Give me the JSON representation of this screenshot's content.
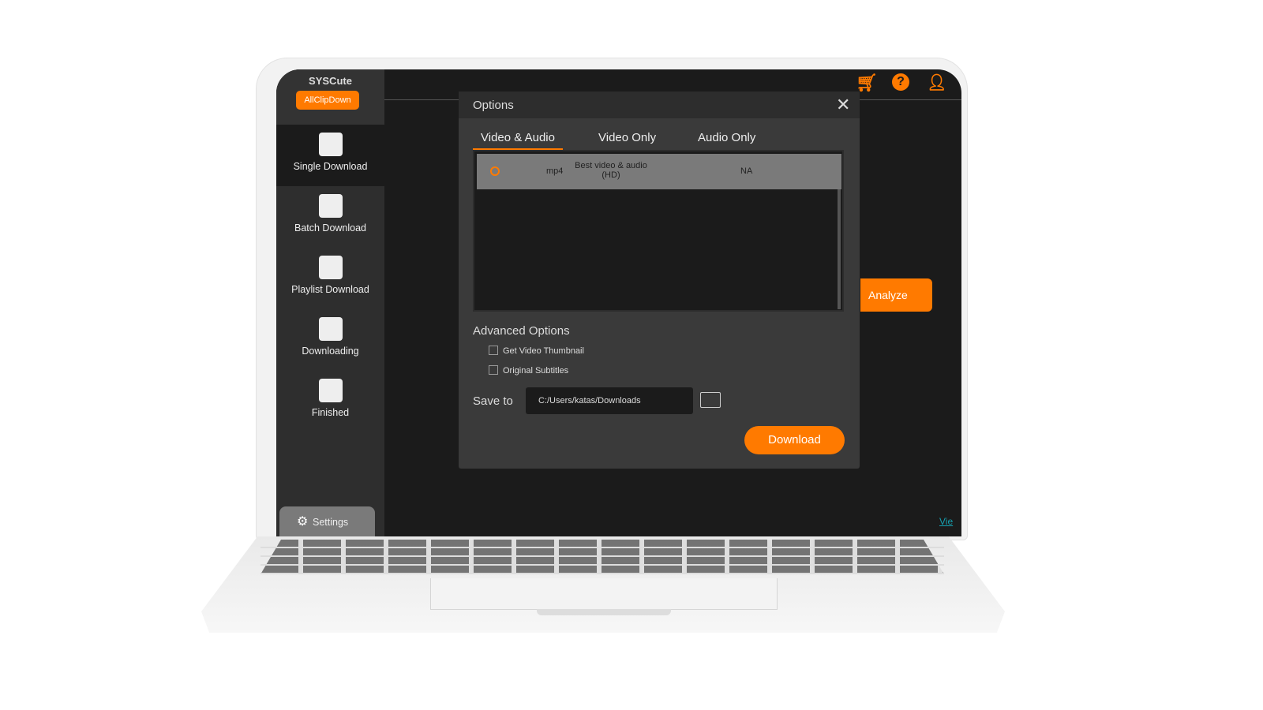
{
  "brand": {
    "name": "SYSCute",
    "product": "AllClipDown"
  },
  "sidebar": {
    "items": [
      {
        "label": "Single Download",
        "icon": "download-box-icon",
        "active": true
      },
      {
        "label": "Batch Download",
        "icon": "batch-download-icon"
      },
      {
        "label": "Playlist Download",
        "icon": "playlist-icon"
      },
      {
        "label": "Downloading",
        "icon": "downloading-icon"
      },
      {
        "label": "Finished",
        "icon": "film-icon"
      }
    ],
    "settings": "Settings"
  },
  "header": {
    "icons": [
      "cart-icon",
      "help-icon",
      "user-add-icon"
    ]
  },
  "main": {
    "analyze": "Analyze",
    "view_link": "Vie"
  },
  "dialog": {
    "title": "Options",
    "tabs": [
      {
        "label": "Video & Audio",
        "active": true
      },
      {
        "label": "Video Only"
      },
      {
        "label": "Audio Only"
      }
    ],
    "rows": [
      {
        "format": "mp4",
        "quality": "Best video & audio",
        "quality2": "(HD)",
        "size": "NA",
        "selected": true
      }
    ],
    "advanced": "Advanced Options",
    "thumbnail": "Get Video Thumbnail",
    "subtitles": "Original Subtitles",
    "save_to_label": "Save to",
    "save_path": "C:/Users/katas/Downloads",
    "download": "Download"
  },
  "colors": {
    "accent": "#ff7a00",
    "background": "#1b1b1b",
    "dialog": "#3a3a3a"
  }
}
